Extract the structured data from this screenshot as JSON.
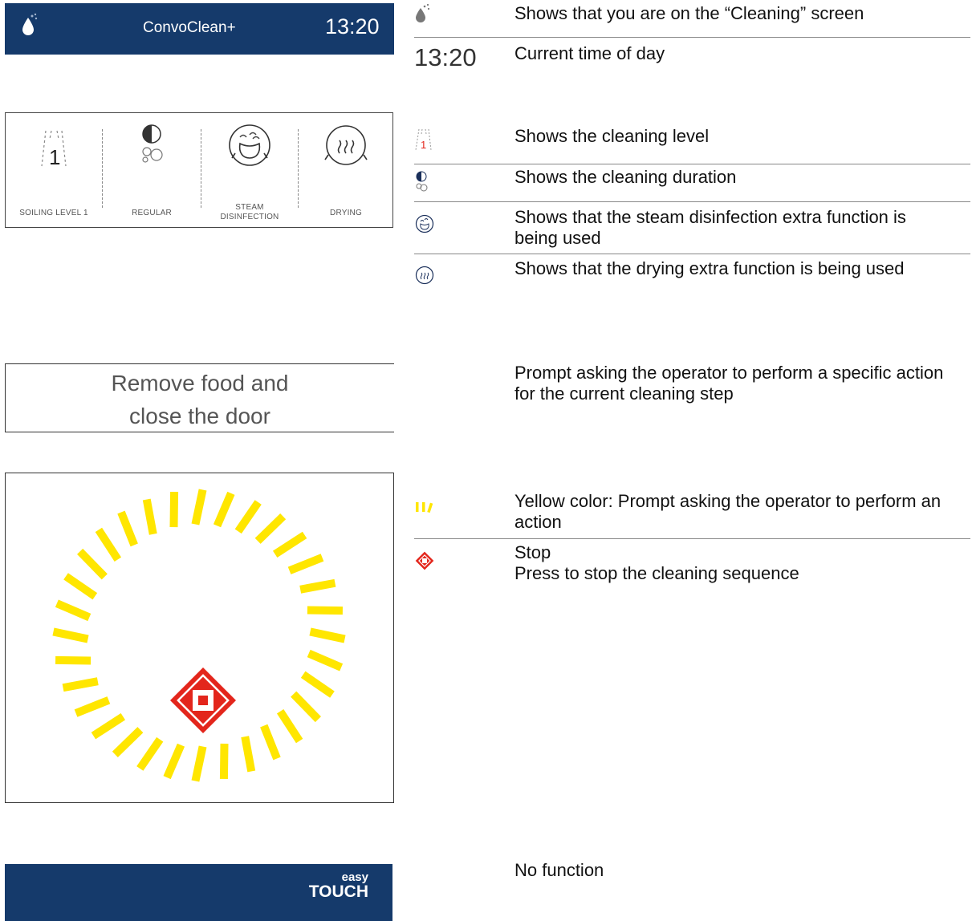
{
  "header": {
    "title": "ConvoClean+",
    "time": "13:20"
  },
  "status_strip": {
    "items": [
      {
        "label": "SOILING LEVEL 1",
        "level": "1"
      },
      {
        "label": "REGULAR"
      },
      {
        "label": "STEAM DISINFECTION",
        "label_line1": "STEAM",
        "label_line2": "DISINFECTION"
      },
      {
        "label": "DRYING"
      }
    ]
  },
  "prompt": {
    "line1": "Remove food and",
    "line2": "close the door"
  },
  "action_panel": {
    "ring_color": "#ffe600",
    "stop_color": "#e3261c"
  },
  "bottom_bar": {
    "logo_line1": "easy",
    "logo_line2": "TOUCH"
  },
  "legend": {
    "cleaning_screen": "Shows that you are on the “Cleaning” screen",
    "time_sample": "13:20",
    "time_desc": "Current time of day",
    "level_num": "1",
    "level_desc": "Shows the cleaning level",
    "duration_desc": "Shows the cleaning duration",
    "steam_desc": "Shows that the steam disinfection extra function is being used",
    "drying_desc": "Shows that the drying extra function is being used",
    "prompt_desc": "Prompt asking the operator to perform a specific action for the current cleaning step",
    "yellow_desc": "Yellow color: Prompt asking the operator to perform an action",
    "stop_title": "Stop",
    "stop_desc": "Press to stop the cleaning sequence",
    "nofunc_desc": "No function"
  },
  "colors": {
    "navy": "#153a6b",
    "yellow": "#ffe600",
    "red": "#e3261c"
  }
}
